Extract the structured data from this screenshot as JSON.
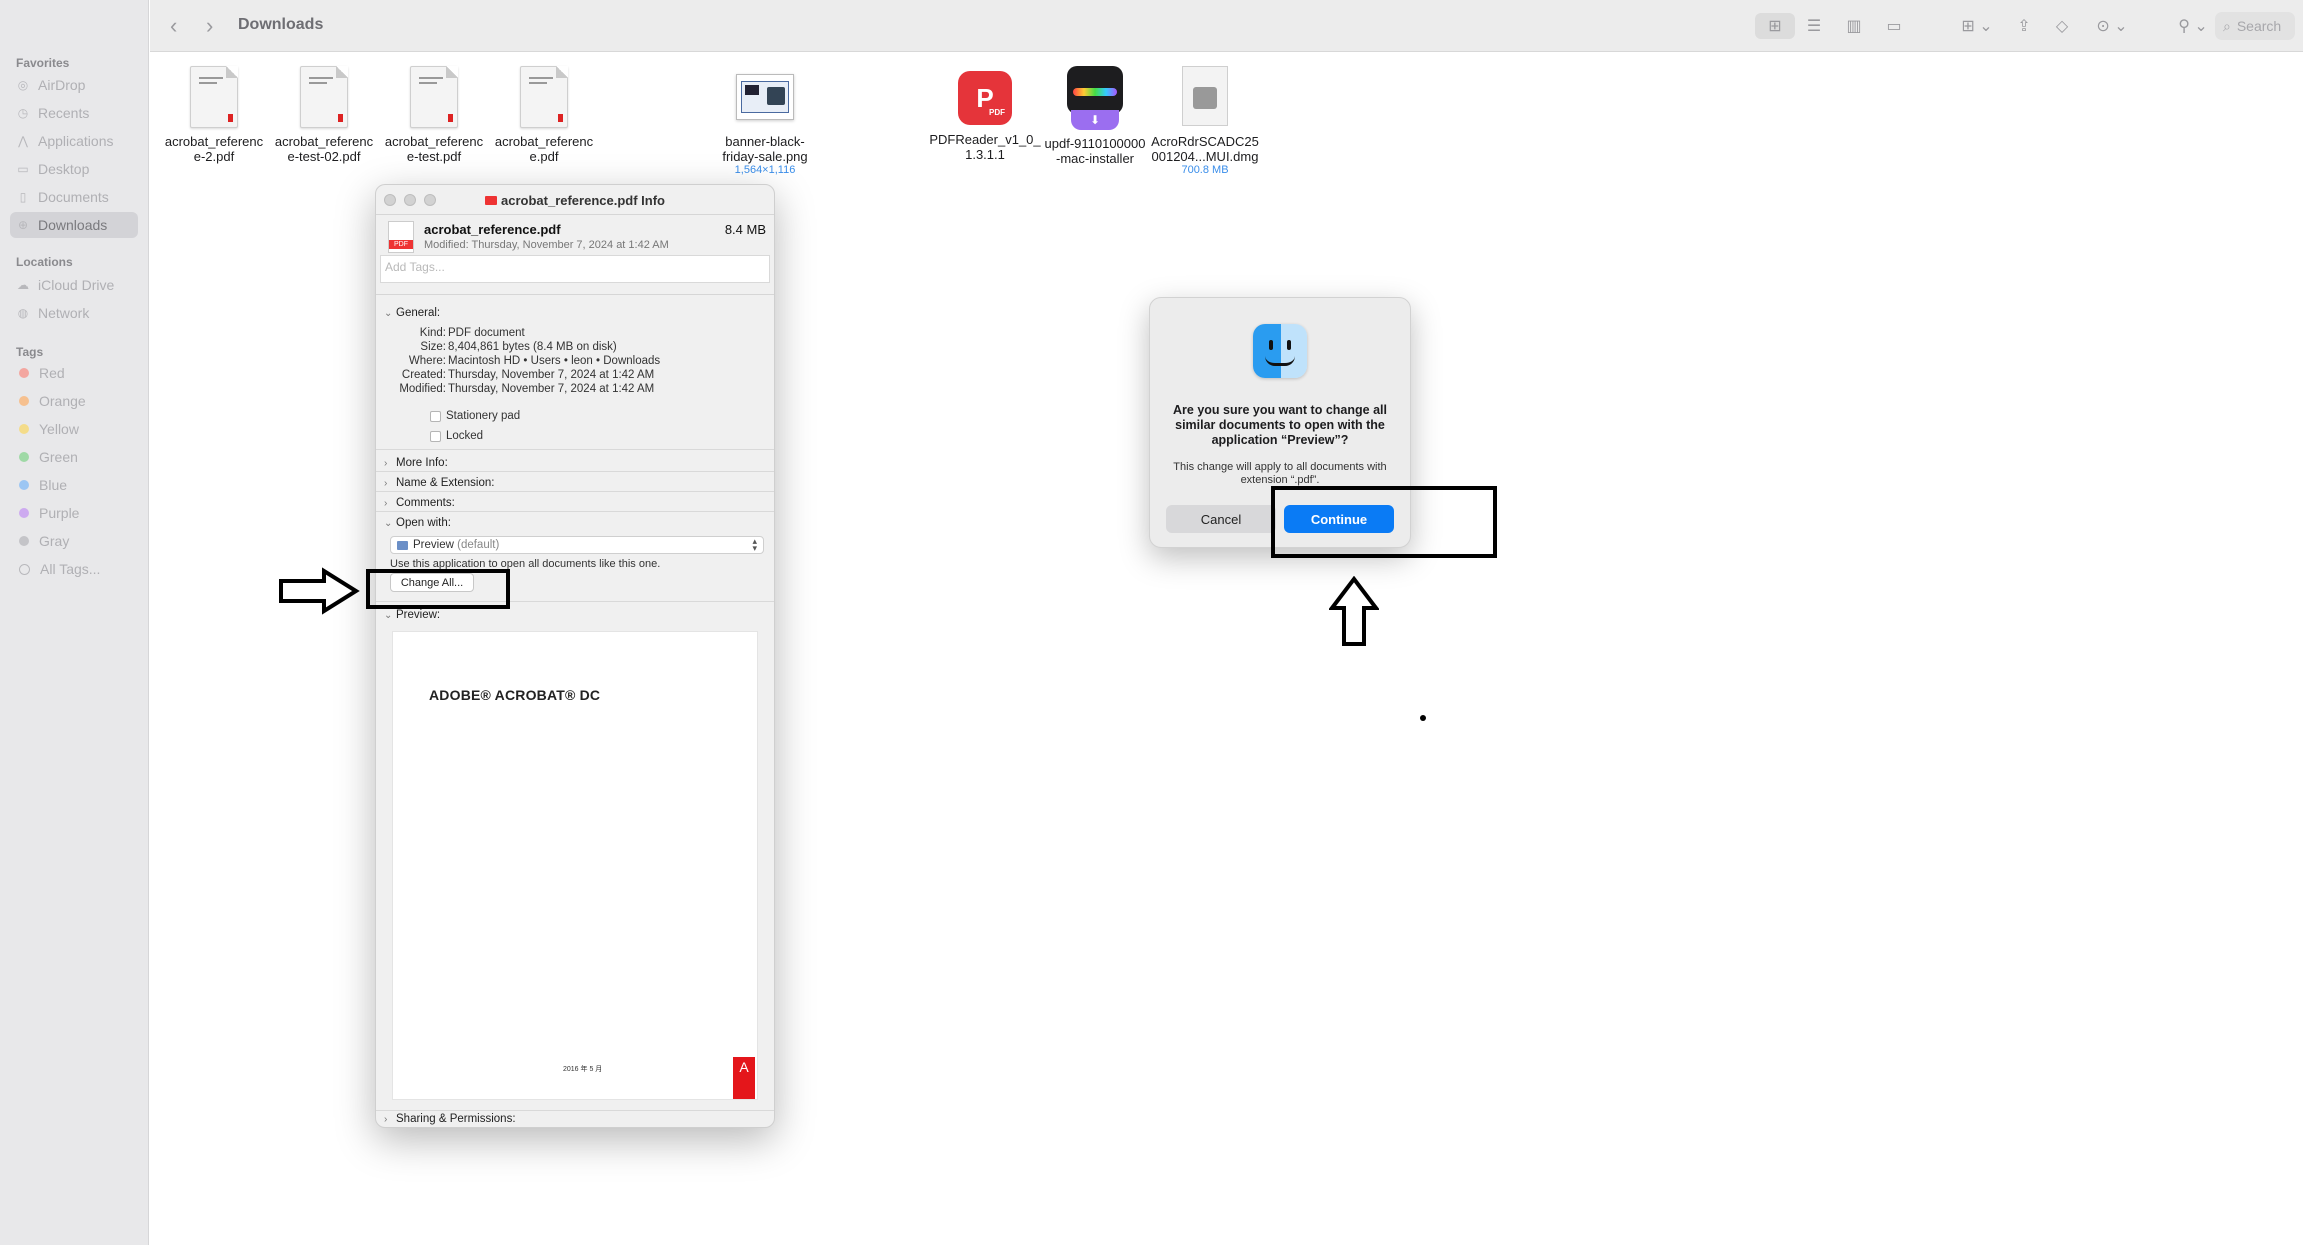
{
  "toolbar": {
    "title": "Downloads",
    "search_placeholder": "Search"
  },
  "sidebar": {
    "favorites_header": "Favorites",
    "favorites": [
      {
        "label": "AirDrop",
        "icon": "airdrop-icon"
      },
      {
        "label": "Recents",
        "icon": "clock-icon"
      },
      {
        "label": "Applications",
        "icon": "applications-icon"
      },
      {
        "label": "Desktop",
        "icon": "desktop-icon"
      },
      {
        "label": "Documents",
        "icon": "document-icon"
      },
      {
        "label": "Downloads",
        "icon": "download-icon",
        "active": true
      }
    ],
    "locations_header": "Locations",
    "locations": [
      {
        "label": "iCloud Drive",
        "icon": "cloud-icon"
      },
      {
        "label": "Network",
        "icon": "globe-icon"
      }
    ],
    "tags_header": "Tags",
    "tags": [
      {
        "label": "Red",
        "color": "#f3a6a0"
      },
      {
        "label": "Orange",
        "color": "#f6c08f"
      },
      {
        "label": "Yellow",
        "color": "#f4dc8a"
      },
      {
        "label": "Green",
        "color": "#9fd9a6"
      },
      {
        "label": "Blue",
        "color": "#9cc6f3"
      },
      {
        "label": "Purple",
        "color": "#cdaaf0"
      },
      {
        "label": "Gray",
        "color": "#c4c4c8"
      },
      {
        "label": "All Tags...",
        "color": "outline"
      }
    ]
  },
  "files": [
    {
      "name_line1": "acrobat_referenc",
      "name_line2": "e-2.pdf",
      "meta": ""
    },
    {
      "name_line1": "acrobat_referenc",
      "name_line2": "e-test-02.pdf",
      "meta": ""
    },
    {
      "name_line1": "acrobat_referenc",
      "name_line2": "e-test.pdf",
      "meta": ""
    },
    {
      "name_line1": "acrobat_referenc",
      "name_line2": "e.pdf",
      "meta": ""
    },
    {
      "name_line1": "banner-black-",
      "name_line2": "friday-sale.png",
      "meta": "1,564×1,116"
    },
    {
      "name_line1": "PDFReader_v1_0_",
      "name_line2": "1.3.1.1",
      "meta": ""
    },
    {
      "name_line1": "updf-9110100000",
      "name_line2": "-mac-installer",
      "meta": ""
    },
    {
      "name_line1": "AcroRdrSCADC25",
      "name_line2": "001204...MUI.dmg",
      "meta": "700.8 MB"
    }
  ],
  "info_window": {
    "title": "acrobat_reference.pdf Info",
    "filename": "acrobat_reference.pdf",
    "size": "8.4 MB",
    "modified": "Modified: Thursday, November 7, 2024 at 1:42 AM",
    "tags_placeholder": "Add Tags...",
    "general": {
      "header": "General:",
      "rows": [
        {
          "label": "Kind:",
          "value": "PDF document"
        },
        {
          "label": "Size:",
          "value": "8,404,861 bytes (8.4 MB on disk)"
        },
        {
          "label": "Where:",
          "value": "Macintosh HD • Users • leon • Downloads"
        },
        {
          "label": "Created:",
          "value": "Thursday, November 7, 2024 at 1:42 AM"
        },
        {
          "label": "Modified:",
          "value": "Thursday, November 7, 2024 at 1:42 AM"
        }
      ],
      "stationery": "Stationery pad",
      "locked": "Locked"
    },
    "more_info": "More Info:",
    "name_ext": "Name & Extension:",
    "comments": "Comments:",
    "open_with": "Open with:",
    "open_with_app": "Preview",
    "open_with_default": "(default)",
    "use_app_text": "Use this application to open all documents like this one.",
    "change_all": "Change All...",
    "preview": "Preview:",
    "preview_title": "ADOBE® ACROBAT® DC",
    "preview_date": "2016 年 5 月",
    "sharing": "Sharing & Permissions:"
  },
  "alert": {
    "title": "Are you sure you want to change all similar documents to open with the application “Preview”?",
    "message": "This change will apply to all documents with extension “.pdf”.",
    "cancel": "Cancel",
    "continue": "Continue"
  }
}
